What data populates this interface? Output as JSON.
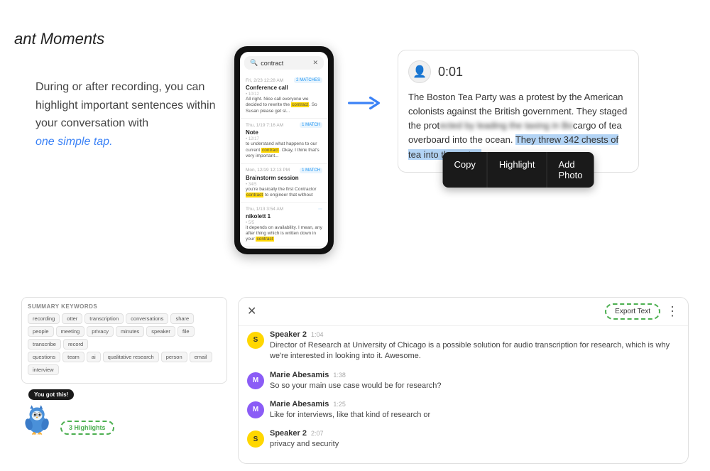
{
  "title": "ant Moments",
  "left": {
    "paragraph": "During or after recording, you can highlight important sentences within your conversation with",
    "italic": "one simple tap."
  },
  "phone": {
    "search_placeholder": "contract",
    "items": [
      {
        "date": "Fri, 2/23  12:28 AM",
        "title": "Conference call",
        "badge": "2 MATCHES",
        "subtitle": "•  10/12",
        "text": "All right. Nice call everyone we decided to rewrite the contract. So Susan please get sl..."
      },
      {
        "date": "Thu, 1/19  7:16 AM",
        "title": "Note",
        "badge": "1 MATCH",
        "subtitle": "• 12/17",
        "text": "to understand what happens to our current contract. Okay, I think that's very important..."
      },
      {
        "date": "Mon, 12/19  12:13 PM",
        "title": "Brainstorm session",
        "badge": "1 MATCH",
        "subtitle": "• 34/5",
        "text": "you're basically the first Contractor contract to engineer that without"
      },
      {
        "date": "Thu, 1/13  3:54 AM",
        "title": "nikolett 1",
        "badge": "",
        "subtitle": "• 5/5",
        "text": "it depends on availability. I mean, any after thing which is written down in your contract"
      }
    ]
  },
  "content_card": {
    "timestamp": "0:01",
    "text_before": "The Boston Tea Party was a protest by the American colonists against the British government. They staged the prot",
    "text_blurred": "ected by leading the taxing in Bo",
    "text_before2": "cargo of tea overboard into the ocean. ",
    "text_selected": "They threw 342 chests of tea into the water.",
    "context_menu": {
      "copy": "Copy",
      "highlight": "Highlight",
      "add_photo": "Add Photo"
    }
  },
  "keywords": {
    "label": "SUMMARY KEYWORDS",
    "row1": [
      "recording",
      "otter",
      "transcription",
      "conversations",
      "share",
      "people",
      "meeting",
      "privacy",
      "minutes",
      "speaker",
      "file",
      "transcribe",
      "record"
    ],
    "row2": [
      "questions",
      "team",
      "ai",
      "qualitative research",
      "person",
      "email",
      "interview"
    ]
  },
  "highlights_count": "3 Highlights",
  "mascot_bubble": "You got this!",
  "conversation": {
    "export_label": "Export Text",
    "messages": [
      {
        "speaker": "Speaker 2",
        "speaker_initial": "S",
        "color": "yellow",
        "time": "1:04",
        "text": "Director of Research at University of Chicago is a possible solution for audio transcription for research, which is why we're interested in looking into it. Awesome."
      },
      {
        "speaker": "Marie Abesamis",
        "speaker_initial": "M",
        "color": "purple",
        "time": "1:38",
        "text": "So so your main use case would be for research?"
      },
      {
        "speaker": "Marie Abesamis",
        "speaker_initial": "M",
        "color": "purple",
        "time": "1:25",
        "text": "Like for interviews, like that kind of research or"
      },
      {
        "speaker": "Speaker 2",
        "speaker_initial": "S",
        "color": "yellow",
        "time": "2:07",
        "text": "privacy and security"
      }
    ]
  }
}
